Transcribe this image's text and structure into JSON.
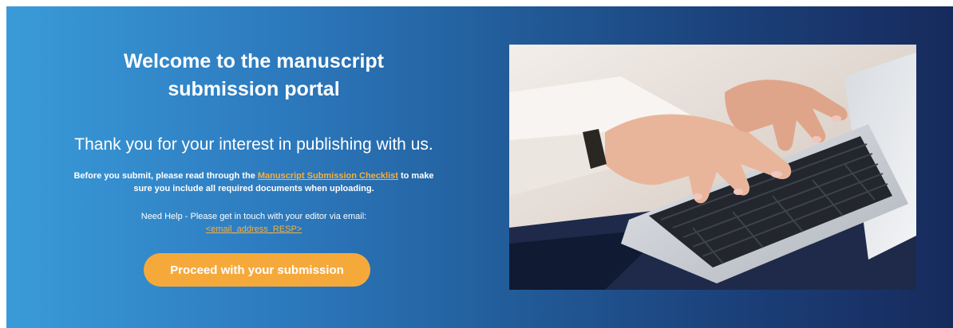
{
  "hero": {
    "title_line1": "Welcome to the manuscript",
    "title_line2": "submission portal",
    "subtitle": "Thank you for your interest in publishing with us.",
    "checklist_before": "Before you submit, please read through the ",
    "checklist_link": "Manuscript Submission Checklist",
    "checklist_after": " to make",
    "checklist_line2": "sure you include all required documents when uploading.",
    "help_text": "Need Help - Please get in touch with your editor via email:",
    "help_email": "<email_address_RESP>",
    "proceed_button": "Proceed with your submission"
  },
  "photo": {
    "icon": "typing-on-laptop-photo"
  },
  "colors": {
    "gradient_start": "#3a9bd9",
    "gradient_end": "#172a5c",
    "accent": "#f6a93b",
    "link": "#f6b040",
    "text": "#ffffff"
  }
}
